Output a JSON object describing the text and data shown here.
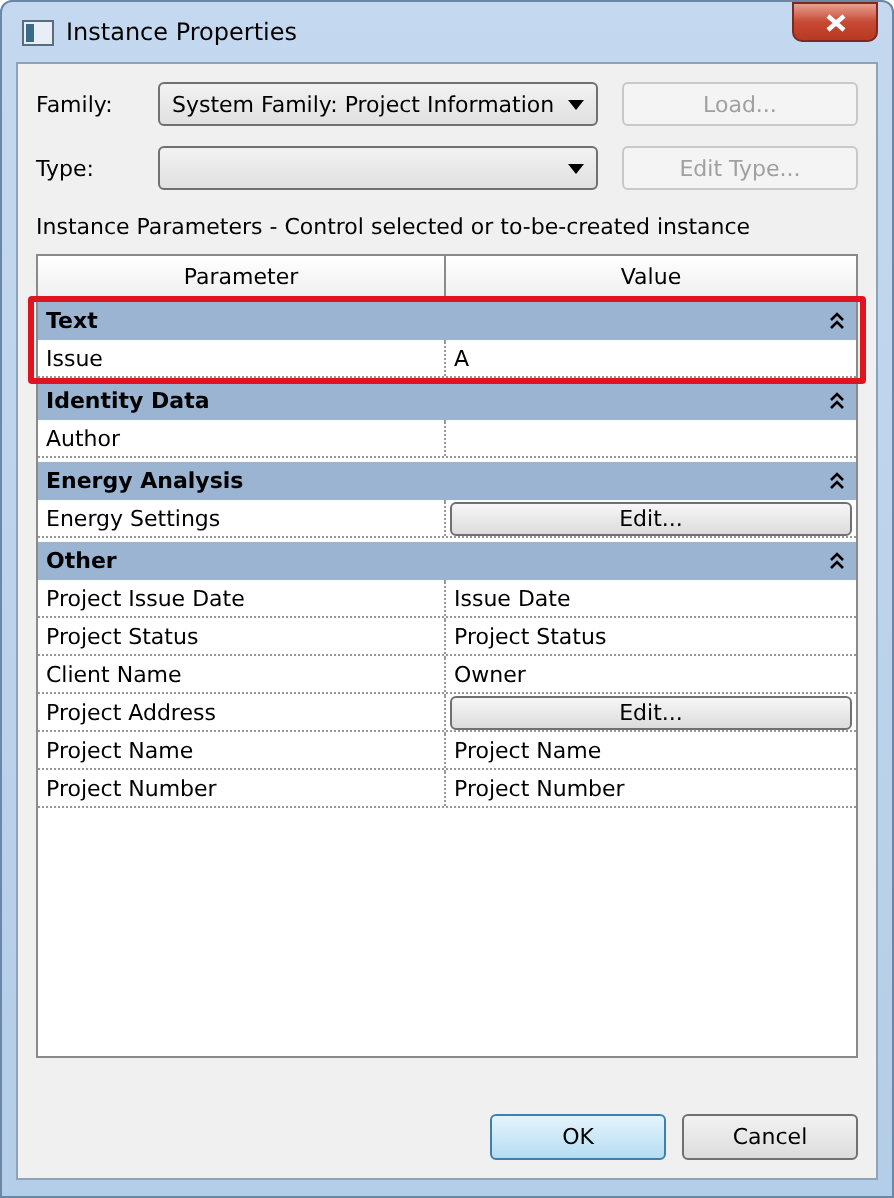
{
  "window": {
    "title": "Instance Properties"
  },
  "family": {
    "label": "Family:",
    "value": "System Family: Project Information"
  },
  "type": {
    "label": "Type:"
  },
  "load_button": {
    "label": "Load...",
    "disabled": true
  },
  "edit_type_button": {
    "label": "Edit Type...",
    "disabled": true
  },
  "caption": "Instance Parameters - Control selected or to-be-created instance",
  "table": {
    "columns": [
      "Parameter",
      "Value"
    ],
    "groups": [
      {
        "name": "Text",
        "expanded": true,
        "highlighted": true,
        "rows": [
          {
            "kind": "text",
            "parameter": "Issue",
            "value": "A"
          }
        ]
      },
      {
        "name": "Identity Data",
        "expanded": true,
        "highlighted": false,
        "rows": [
          {
            "kind": "text",
            "parameter": "Author"
          }
        ]
      },
      {
        "name": "Energy Analysis",
        "expanded": true,
        "highlighted": false,
        "rows": [
          {
            "kind": "button",
            "parameter": "Energy Settings",
            "value": "Edit..."
          }
        ]
      },
      {
        "name": "Other",
        "expanded": true,
        "highlighted": false,
        "rows": [
          {
            "kind": "text",
            "parameter": "Project Issue Date",
            "value": "Issue Date"
          },
          {
            "kind": "text",
            "parameter": "Project Status",
            "value": "Project Status"
          },
          {
            "kind": "text",
            "parameter": "Client Name",
            "value": "Owner"
          },
          {
            "kind": "button",
            "parameter": "Project Address",
            "value": "Edit..."
          },
          {
            "kind": "text",
            "parameter": "Project Name",
            "value": "Project Name"
          },
          {
            "kind": "text",
            "parameter": "Project Number",
            "value": "Project Number"
          }
        ]
      }
    ]
  },
  "buttons": [
    {
      "label": "OK",
      "default": true
    },
    {
      "label": "Cancel",
      "default": false
    }
  ]
}
